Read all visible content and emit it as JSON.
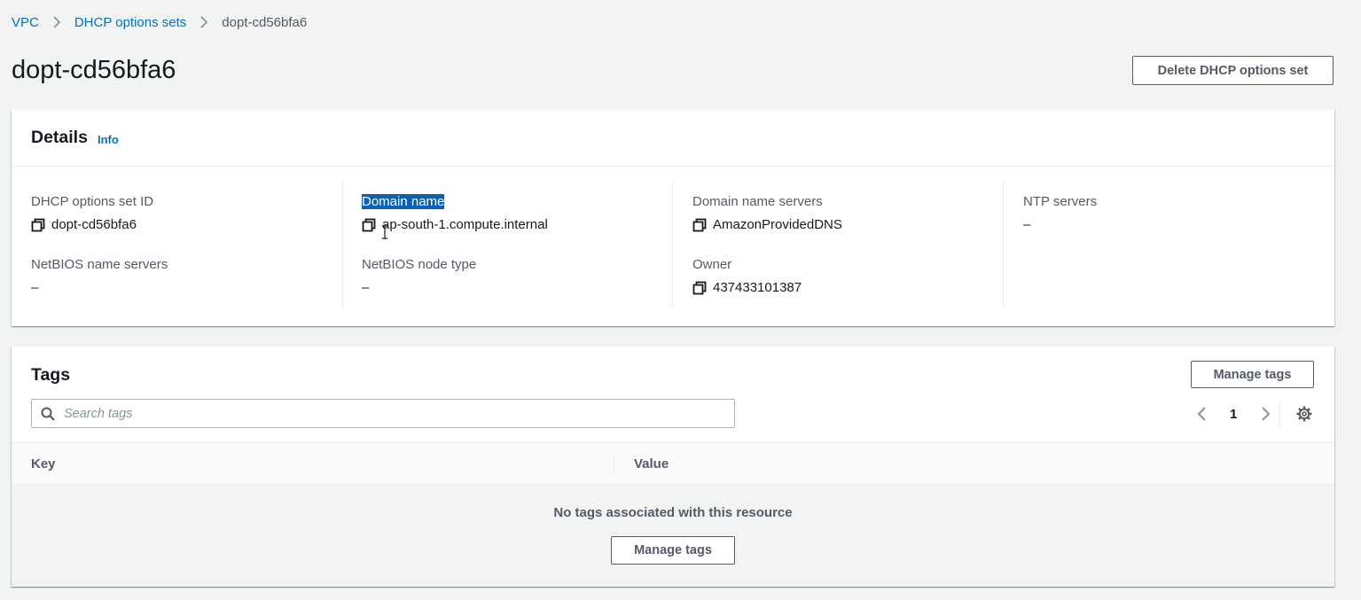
{
  "breadcrumb": {
    "items": [
      {
        "label": "VPC"
      },
      {
        "label": "DHCP options sets"
      },
      {
        "label": "dopt-cd56bfa6"
      }
    ]
  },
  "page": {
    "title": "dopt-cd56bfa6",
    "delete_label": "Delete DHCP options set"
  },
  "details": {
    "title": "Details",
    "info_label": "Info",
    "fields": {
      "dhcp_id": {
        "label": "DHCP options set ID",
        "value": "dopt-cd56bfa6"
      },
      "domain_name": {
        "label": "Domain name",
        "value": "ap-south-1.compute.internal"
      },
      "dns_servers": {
        "label": "Domain name servers",
        "value": "AmazonProvidedDNS"
      },
      "ntp_servers": {
        "label": "NTP servers",
        "value": "–"
      },
      "netbios_servers": {
        "label": "NetBIOS name servers",
        "value": "–"
      },
      "netbios_node": {
        "label": "NetBIOS node type",
        "value": "–"
      },
      "owner": {
        "label": "Owner",
        "value": "437433101387"
      }
    }
  },
  "tags": {
    "title": "Tags",
    "manage_label": "Manage tags",
    "search_placeholder": "Search tags",
    "page": "1",
    "columns": {
      "key": "Key",
      "value": "Value"
    },
    "empty_text": "No tags associated with this resource",
    "empty_manage_label": "Manage tags"
  },
  "colors": {
    "link": "#0073bb",
    "text": "#16191f",
    "muted": "#545b64",
    "background": "#f2f3f3",
    "selection": "#0a5fb4"
  }
}
